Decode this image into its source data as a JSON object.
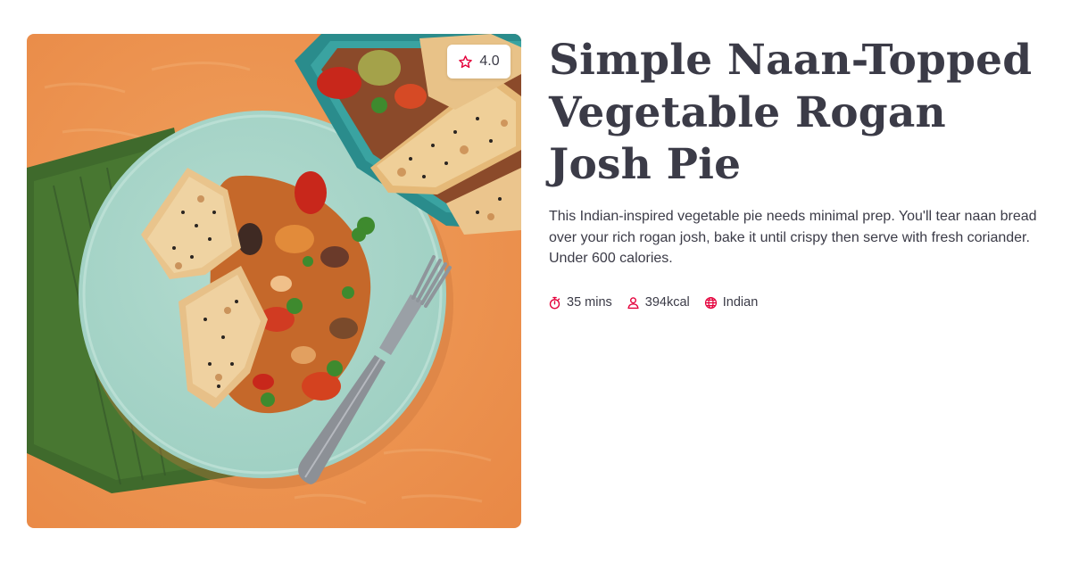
{
  "recipe": {
    "title": "Simple Naan-Topped Vegetable Rogan Josh Pie",
    "description": "This Indian-inspired vegetable pie needs minimal prep. You'll tear naan bread over your rich rogan josh, bake it until crispy then serve with fresh coriander. Under 600 calories.",
    "rating": "4.0",
    "meta": {
      "time": "35 mins",
      "calories": "394kcal",
      "cuisine": "Indian"
    }
  },
  "icons": {
    "rating": "star-outline-icon",
    "time": "stopwatch-icon",
    "calories": "person-icon",
    "cuisine": "globe-icon"
  },
  "colors": {
    "accent": "#e4003b",
    "text": "#3b3b47",
    "background": "#ffffff"
  }
}
